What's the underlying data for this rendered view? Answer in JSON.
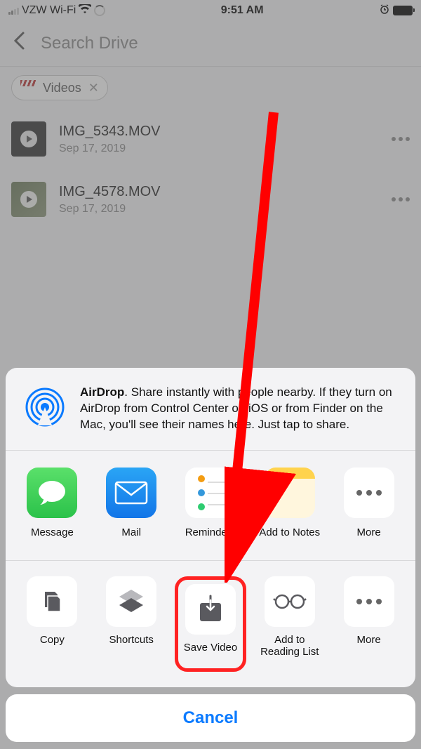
{
  "status": {
    "carrier": "VZW Wi-Fi",
    "time": "9:51 AM"
  },
  "header": {
    "search_placeholder": "Search Drive"
  },
  "filter": {
    "label": "Videos"
  },
  "files": [
    {
      "name": "IMG_5343.MOV",
      "date": "Sep 17, 2019"
    },
    {
      "name": "IMG_4578.MOV",
      "date": "Sep 17, 2019"
    }
  ],
  "airdrop": {
    "title": "AirDrop",
    "text": ". Share instantly with people nearby. If they turn on AirDrop from Control Center on iOS or from Finder on the Mac, you'll see their names here. Just tap to share."
  },
  "apps": [
    {
      "label": "Message"
    },
    {
      "label": "Mail"
    },
    {
      "label": "Reminders"
    },
    {
      "label": "Add to Notes"
    },
    {
      "label": "More"
    }
  ],
  "actions": [
    {
      "label": "Copy"
    },
    {
      "label": "Shortcuts"
    },
    {
      "label": "Save Video"
    },
    {
      "label": "Add to Reading List"
    },
    {
      "label": "More"
    }
  ],
  "cancel": "Cancel"
}
